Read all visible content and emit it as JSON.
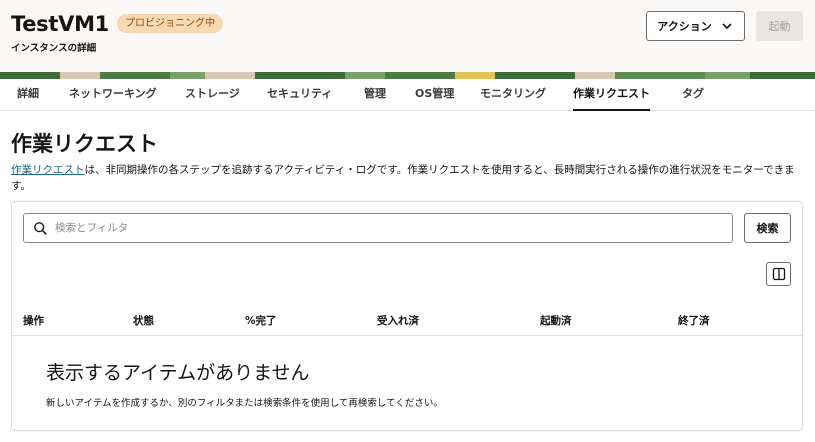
{
  "header": {
    "title": "TestVM1",
    "status_badge": "プロビジョニング中",
    "subtitle": "インスタンスの詳細",
    "action_label": "アクション",
    "start_label": "起動"
  },
  "tabs": [
    {
      "label": "詳細"
    },
    {
      "label": "ネットワーキング"
    },
    {
      "label": "ストレージ"
    },
    {
      "label": "セキュリティ"
    },
    {
      "label": "管理"
    },
    {
      "label": "OS管理"
    },
    {
      "label": "モニタリング"
    },
    {
      "label": "作業リクエスト"
    },
    {
      "label": "タグ"
    }
  ],
  "active_tab": "作業リクエスト",
  "main": {
    "heading": "作業リクエスト",
    "description_link": "作業リクエスト",
    "description_text": "は、非同期操作の各ステップを追跡するアクティビティ・ログです。作業リクエストを使用すると、長時間実行される操作の進行状況をモニターできます。",
    "search_placeholder": "検索とフィルタ",
    "search_value": "",
    "search_button": "検索",
    "columns": [
      "操作",
      "状態",
      "%完了",
      "受入れ済",
      "起動済",
      "終了済"
    ],
    "empty_title": "表示するアイテムがありません",
    "empty_subtitle": "新しいアイテムを作成するか、別のフィルタまたは検索条件を使用して再検索してください。"
  },
  "colors": {
    "badge_bg": "#f9d8b4",
    "badge_text": "#8a4b0c",
    "link": "#206887",
    "banner_green": "#4d7a45",
    "banner_yellow": "#e3c25a"
  },
  "icons": {
    "search": "search-icon",
    "chevron": "chevron-down-icon",
    "columns": "columns-icon"
  }
}
